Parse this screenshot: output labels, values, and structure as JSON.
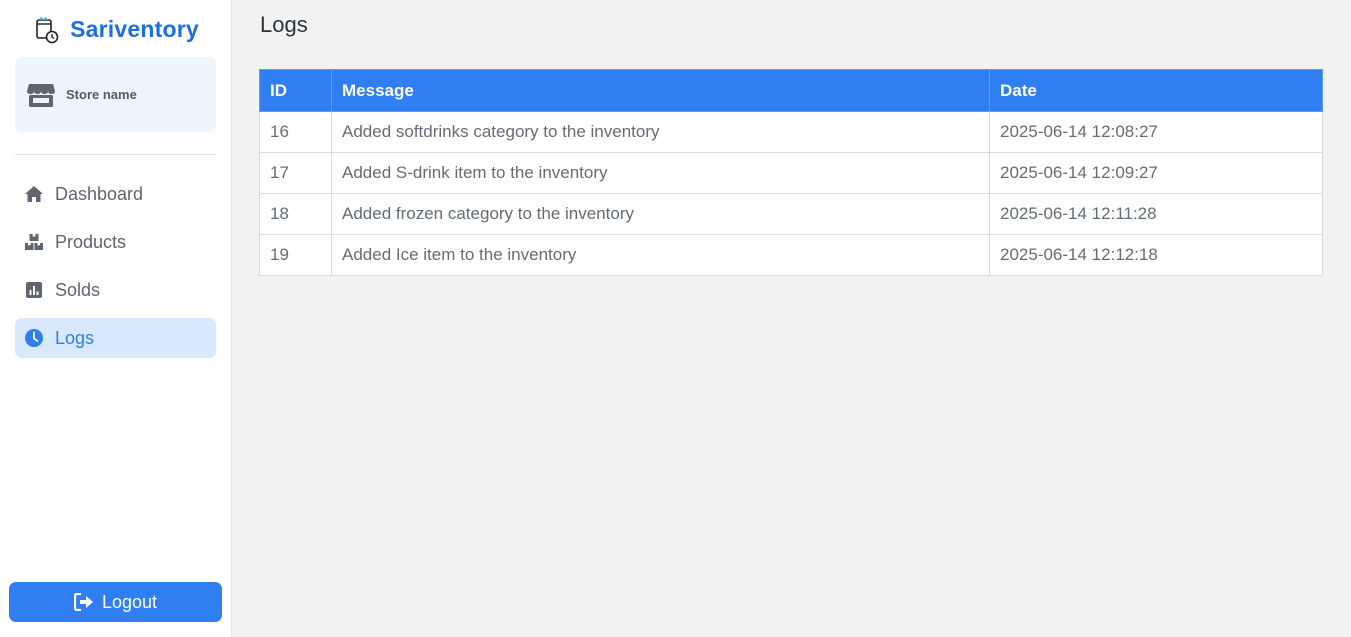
{
  "app": {
    "name": "Sariventory"
  },
  "store": {
    "name": "Store name"
  },
  "nav": {
    "items": [
      {
        "label": "Dashboard",
        "icon": "home-icon"
      },
      {
        "label": "Products",
        "icon": "boxes-icon"
      },
      {
        "label": "Solds",
        "icon": "chart-icon"
      },
      {
        "label": "Logs",
        "icon": "clock-icon"
      }
    ],
    "active": "Logs"
  },
  "logout": {
    "label": "Logout",
    "icon": "logout-icon"
  },
  "page": {
    "title": "Logs"
  },
  "table": {
    "headers": {
      "id": "ID",
      "message": "Message",
      "date": "Date"
    },
    "rows": [
      {
        "id": "16",
        "message": "Added softdrinks category to the inventory",
        "date": "2025-06-14 12:08:27"
      },
      {
        "id": "17",
        "message": "Added S-drink item to the inventory",
        "date": "2025-06-14 12:09:27"
      },
      {
        "id": "18",
        "message": "Added frozen category to the inventory",
        "date": "2025-06-14 12:11:28"
      },
      {
        "id": "19",
        "message": "Added Ice item to the inventory",
        "date": "2025-06-14 12:12:18"
      }
    ]
  },
  "colors": {
    "accent": "#2f7ff2",
    "brand": "#1f6ee0",
    "active_nav_bg": "#d8e8fd",
    "store_card_bg": "#eef5ff"
  }
}
